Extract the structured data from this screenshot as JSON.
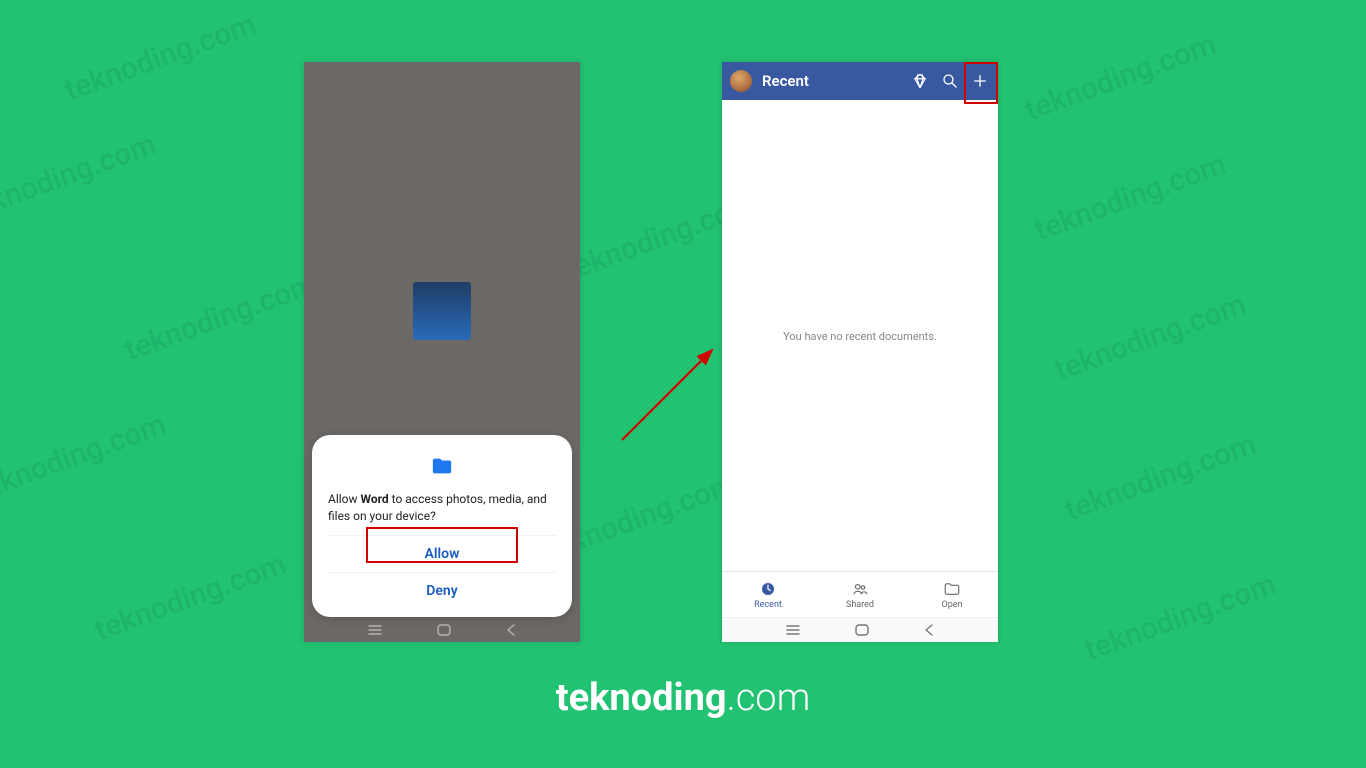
{
  "watermark_text": "teknoding.com",
  "permission": {
    "prefix": "Allow ",
    "app_name": "Word",
    "suffix": " to access photos, media, and files on your device?",
    "allow_label": "Allow",
    "deny_label": "Deny"
  },
  "word_app": {
    "appbar_title": "Recent",
    "empty_message": "You have no recent documents.",
    "tabs": {
      "recent": "Recent",
      "shared": "Shared",
      "open": "Open"
    }
  },
  "footer": {
    "brand_bold": "teknoding",
    "brand_light": ".com"
  }
}
